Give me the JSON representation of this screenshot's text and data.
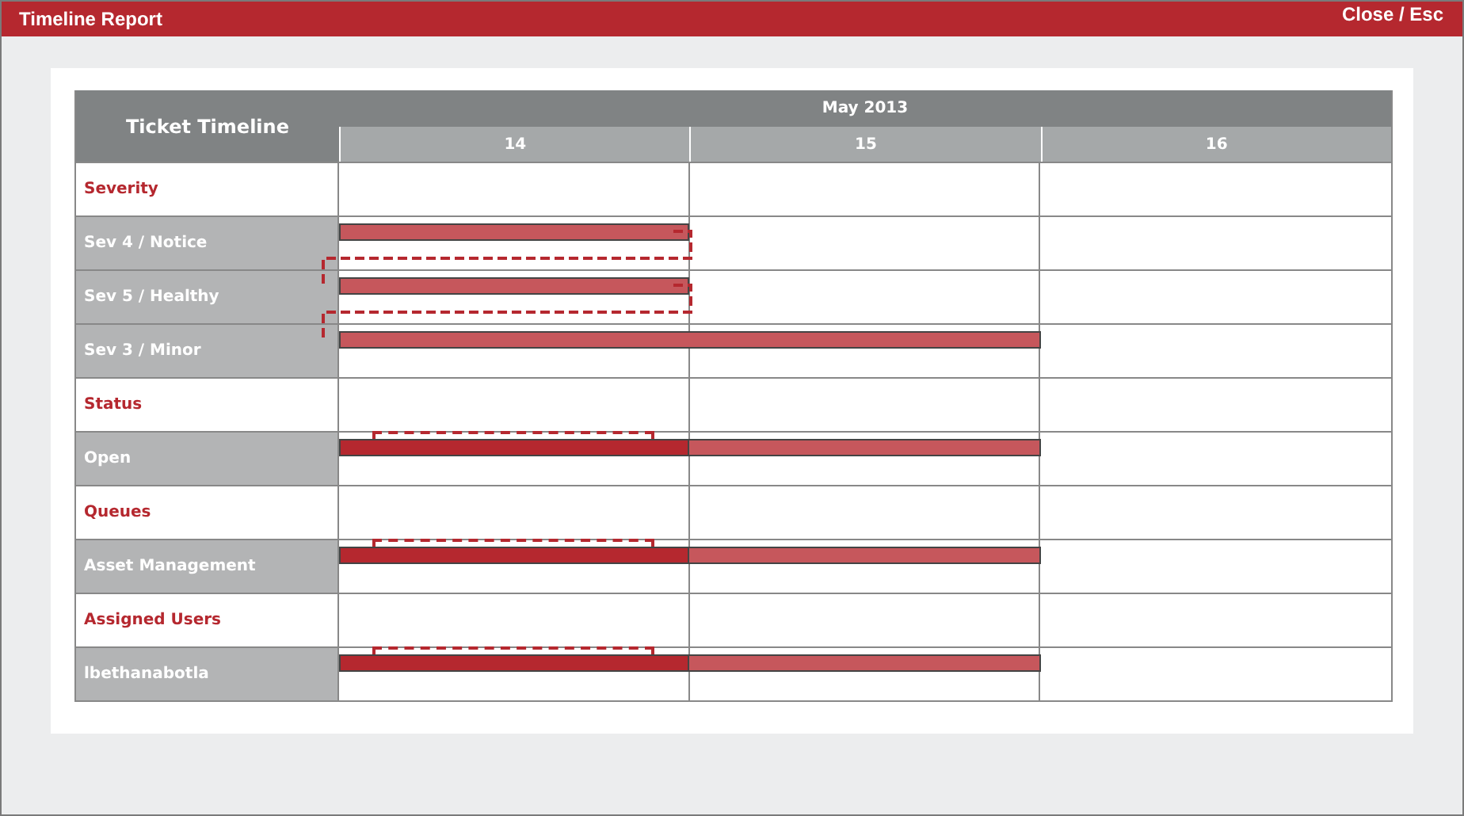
{
  "window": {
    "title": "Timeline Report",
    "close": "Close / Esc"
  },
  "table": {
    "title": "Ticket Timeline",
    "period": "May 2013",
    "days": [
      "14",
      "15",
      "16"
    ],
    "rows": [
      {
        "kind": "section",
        "label": "Severity",
        "segments": []
      },
      {
        "kind": "item",
        "label": "Sev 4 / Notice",
        "outline": {
          "kind": "connector"
        },
        "segments": [
          {
            "kind": "light",
            "level": 0.3333
          }
        ]
      },
      {
        "kind": "item",
        "label": "Sev 5 / Healthy",
        "outline": {
          "kind": "connector"
        },
        "segments": [
          {
            "kind": "light",
            "level": 0.3333
          }
        ]
      },
      {
        "kind": "item",
        "label": "Sev 3 / Minor",
        "segments": [
          {
            "kind": "light",
            "level": 0.6667
          }
        ]
      },
      {
        "kind": "section",
        "label": "Status",
        "segments": []
      },
      {
        "kind": "item",
        "label": "Open",
        "outline": {
          "kind": "bracket"
        },
        "segments": [
          {
            "kind": "light",
            "level": 0.6667
          },
          {
            "kind": "dark",
            "level": 0.3333
          }
        ]
      },
      {
        "kind": "section",
        "label": "Queues",
        "segments": []
      },
      {
        "kind": "item",
        "label": "Asset Management",
        "outline": {
          "kind": "bracket"
        },
        "segments": [
          {
            "kind": "light",
            "level": 0.6667
          },
          {
            "kind": "dark",
            "level": 0.3333
          }
        ]
      },
      {
        "kind": "section",
        "label": "Assigned Users",
        "segments": []
      },
      {
        "kind": "item",
        "label": "lbethanabotla",
        "outline": {
          "kind": "bracket"
        },
        "segments": [
          {
            "kind": "light",
            "level": 0.6667
          },
          {
            "kind": "dark",
            "level": 0.3333
          }
        ]
      }
    ]
  }
}
